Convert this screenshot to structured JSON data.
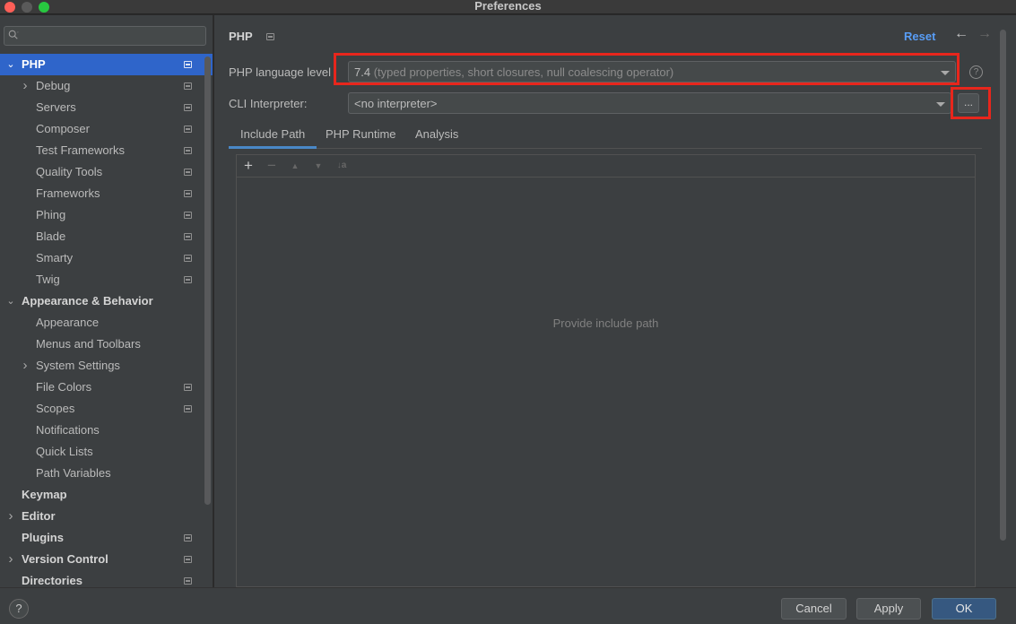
{
  "window": {
    "title": "Preferences"
  },
  "search": {
    "value": ""
  },
  "sidebar": {
    "items": [
      {
        "label": "PHP",
        "expanded": true,
        "selected": true,
        "project": true
      },
      {
        "label": "Debug",
        "collapsed": true,
        "project": true
      },
      {
        "label": "Servers",
        "project": true
      },
      {
        "label": "Composer",
        "project": true
      },
      {
        "label": "Test Frameworks",
        "project": true
      },
      {
        "label": "Quality Tools",
        "project": true
      },
      {
        "label": "Frameworks",
        "project": true
      },
      {
        "label": "Phing",
        "project": true
      },
      {
        "label": "Blade",
        "project": true
      },
      {
        "label": "Smarty",
        "project": true
      },
      {
        "label": "Twig",
        "project": true
      },
      {
        "label": "Appearance & Behavior",
        "expanded": true
      },
      {
        "label": "Appearance"
      },
      {
        "label": "Menus and Toolbars"
      },
      {
        "label": "System Settings",
        "collapsed": true
      },
      {
        "label": "File Colors",
        "project": true
      },
      {
        "label": "Scopes",
        "project": true
      },
      {
        "label": "Notifications"
      },
      {
        "label": "Quick Lists"
      },
      {
        "label": "Path Variables"
      },
      {
        "label": "Keymap"
      },
      {
        "label": "Editor",
        "collapsed": true
      },
      {
        "label": "Plugins",
        "project": true
      },
      {
        "label": "Version Control",
        "collapsed": true,
        "project": true
      },
      {
        "label": "Directories",
        "project": true
      }
    ]
  },
  "main": {
    "title": "PHP",
    "reset_label": "Reset",
    "back_icon": "←",
    "forward_icon": "→",
    "language_level": {
      "label": "PHP language level",
      "version": "7.4",
      "description": "(typed properties, short closures, null coalescing operator)"
    },
    "cli_interpreter": {
      "label": "CLI Interpreter:",
      "value": "<no interpreter>",
      "browse_label": "..."
    },
    "help_icon": "?",
    "tabs": [
      {
        "label": "Include Path",
        "active": true
      },
      {
        "label": "PHP Runtime"
      },
      {
        "label": "Analysis"
      }
    ],
    "toolbar": {
      "add": "+",
      "remove": "−",
      "up": "▲",
      "down": "▼",
      "sort": "↓a"
    },
    "empty_text": "Provide include path"
  },
  "highlight_color": "#e8261c",
  "accent_color": "#2f65ca",
  "footer": {
    "help_icon": "?",
    "cancel_label": "Cancel",
    "apply_label": "Apply",
    "ok_label": "OK"
  }
}
